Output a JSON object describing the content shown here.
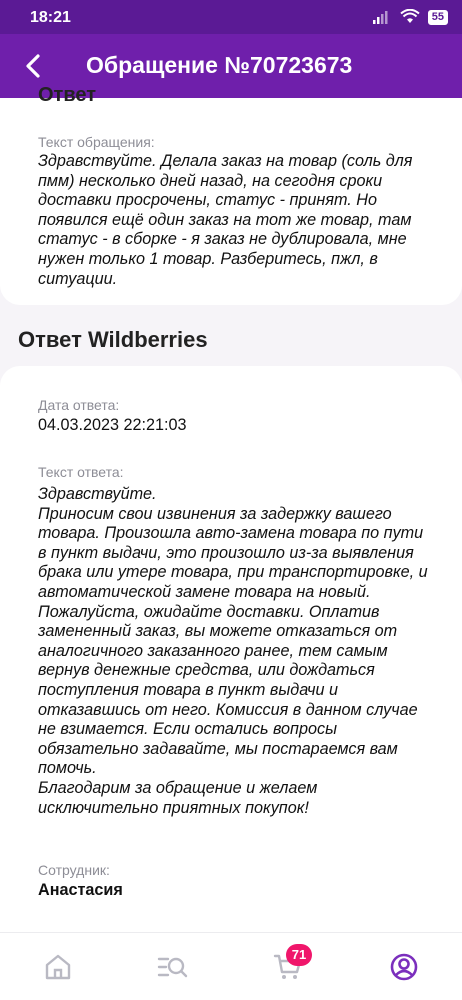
{
  "status_bar": {
    "time": "18:21",
    "battery": "55"
  },
  "header": {
    "title": "Обращение №70723673"
  },
  "request": {
    "text_label": "Текст обращения:",
    "text": "Здравствуйте. Делала заказ на товар (соль для пмм) несколько дней назад, на сегодня сроки доставки просрочены, статус - принят. Но появился ещё один заказ на тот же товар, там статус - в сборке - я заказ  не дублировала, мне нужен только 1 товар. Разберитесь, пжл, в ситуации."
  },
  "answer": {
    "section_title": "Ответ Wildberries",
    "date_label": "Дата ответа:",
    "date": "04.03.2023 22:21:03",
    "text_label": "Текст ответа:",
    "text": "Здравствуйте.\nПриносим свои извинения за задержку вашего товара. Произошла авто-замена товара по пути в пункт выдачи, это произошло из-за выявления брака или утере товара, при транспортировке, и автоматической замене товара на новый.\nПожалуйста, ожидайте доставки. Оплатив замененный заказ, вы можете отказаться от аналогичного заказанного ранее, тем самым вернув денежные средства, или дождаться поступления товара в пункт выдачи и отказавшись от него. Комиссия в данном случае не взимается. Если остались вопросы обязательно задавайте, мы постараемся вам помочь.\nБлагодарим за обращение и желаем исключительно приятных покупок!",
    "employee_label": "Сотрудник:",
    "employee": "Анастасия"
  },
  "bottom_nav": {
    "items": [
      "home-icon",
      "catalog-search-icon",
      "cart-icon",
      "profile-icon"
    ],
    "cart_badge": "71"
  },
  "colors": {
    "header": "#6f1fab",
    "status_bar": "#5b1a95",
    "badge": "#f0166b",
    "active_nav": "#7b2fbd",
    "inactive_nav": "#b9b9c3"
  }
}
